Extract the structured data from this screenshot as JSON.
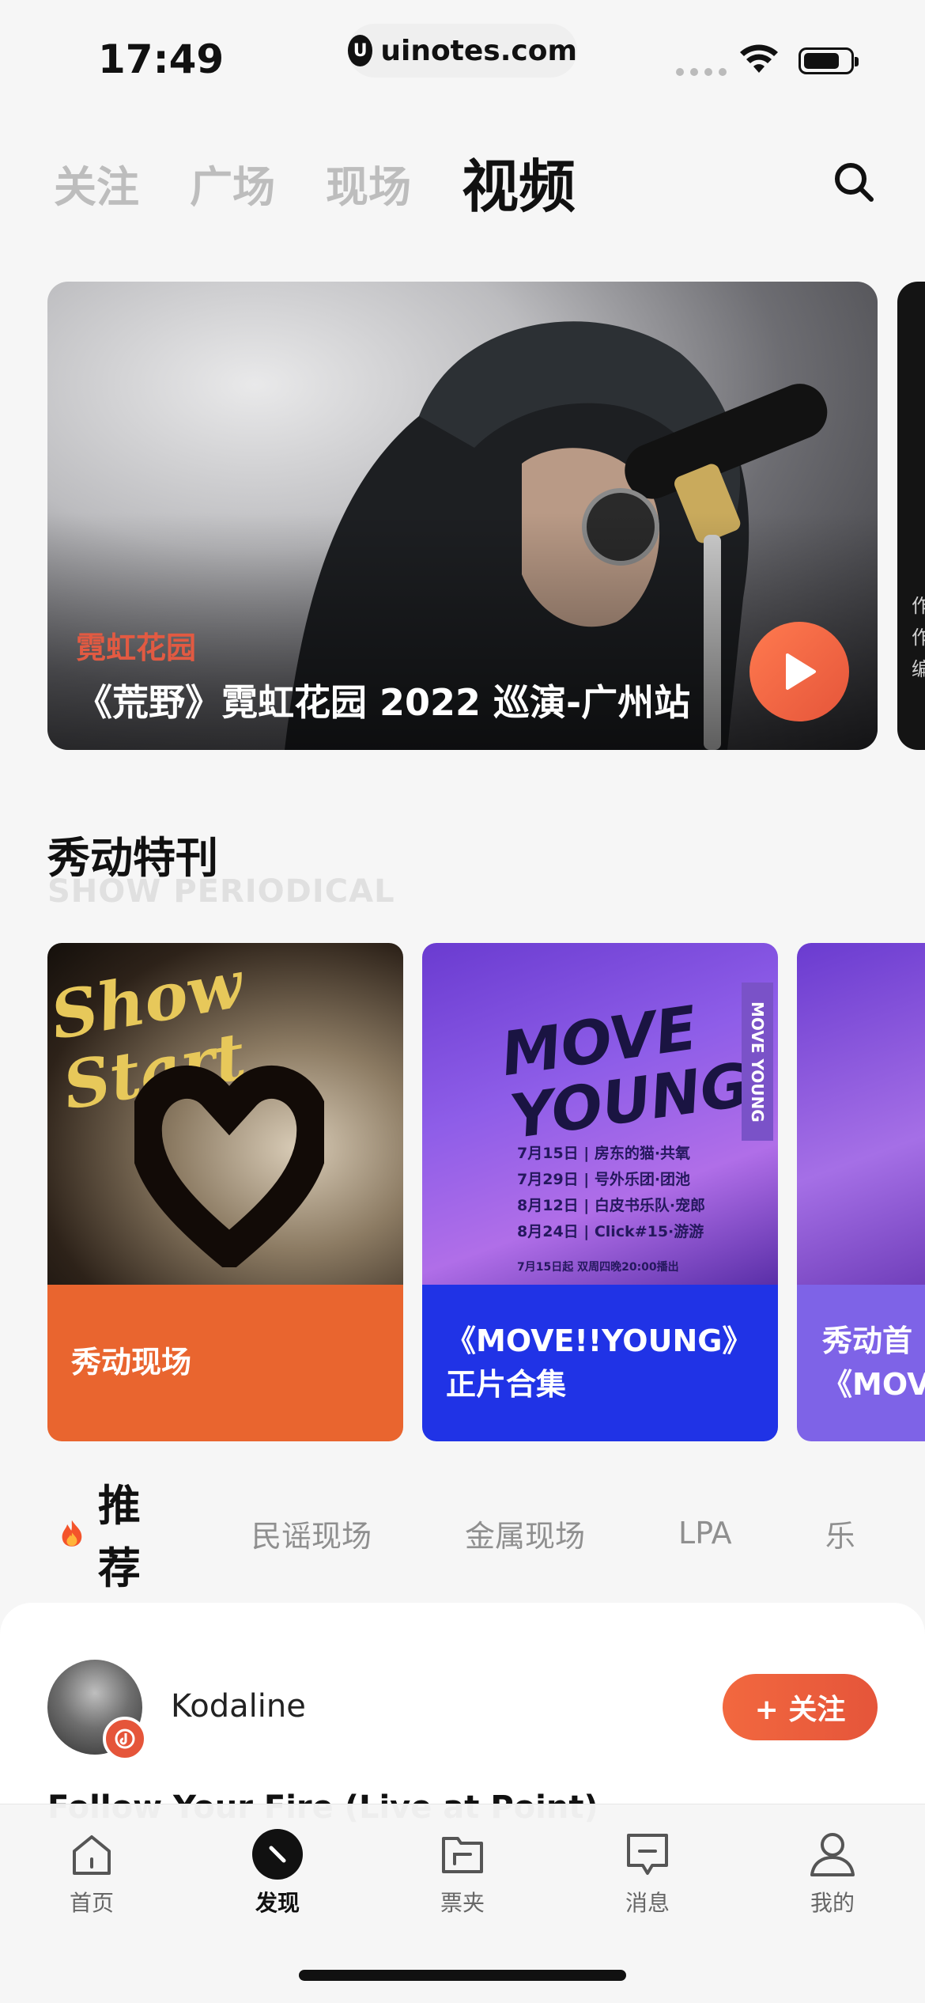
{
  "status_bar": {
    "time": "17:49",
    "url": "uinotes.com"
  },
  "top_tabs": {
    "items": [
      {
        "label": "关注"
      },
      {
        "label": "广场"
      },
      {
        "label": "现场"
      },
      {
        "label": "视频"
      }
    ],
    "active": "视频"
  },
  "hero": {
    "tag": "霓虹花园",
    "title": "《荒野》霓虹花园 2022 巡演-广州站",
    "peek_lines": [
      "作",
      "作",
      "编"
    ]
  },
  "periodical": {
    "title": "秀动特刊",
    "subtitle": "SHOW PERIODICAL",
    "cards": [
      {
        "label": "秀动现场",
        "art_text": "Show Start"
      },
      {
        "label": "《MOVE!!YOUNG》正片合集",
        "label_line1": "《MOVE!!YOUNG》",
        "label_line2": "正片合集",
        "art_title_line1": "MOVE",
        "art_title_line2": "YOUNG",
        "art_vertical": "MOVE YOUNG",
        "schedule": [
          "7月15日 | 房东的猫·共氧",
          "7月29日 | 号外乐团·团池",
          "8月12日 | 白皮书乐队·宠郎",
          "8月24日 | Click#15·游游"
        ],
        "schedule_footer": "7月15日起 双周四晚20:00播出"
      },
      {
        "label_line1": "秀动首",
        "label_line2": "《MOV"
      }
    ]
  },
  "recommend": {
    "title": "推荐",
    "tabs": [
      "民谣现场",
      "金属现场",
      "LPA",
      "乐"
    ]
  },
  "feed": {
    "artist": "Kodaline",
    "follow_label": "+ 关注",
    "peek_text": "Follow Your Fire (Live at Point)"
  },
  "bottom_nav": {
    "items": [
      {
        "label": "首页",
        "icon": "home-icon"
      },
      {
        "label": "发现",
        "icon": "compass-icon"
      },
      {
        "label": "票夹",
        "icon": "folder-icon"
      },
      {
        "label": "消息",
        "icon": "message-icon"
      },
      {
        "label": "我的",
        "icon": "profile-icon"
      }
    ],
    "active": "发现"
  },
  "colors": {
    "accent": "#e5553a",
    "tag_red": "#e25a42",
    "card_orange": "#e9652f",
    "card_blue": "#2033e6",
    "card_purple": "#7e63e7"
  }
}
